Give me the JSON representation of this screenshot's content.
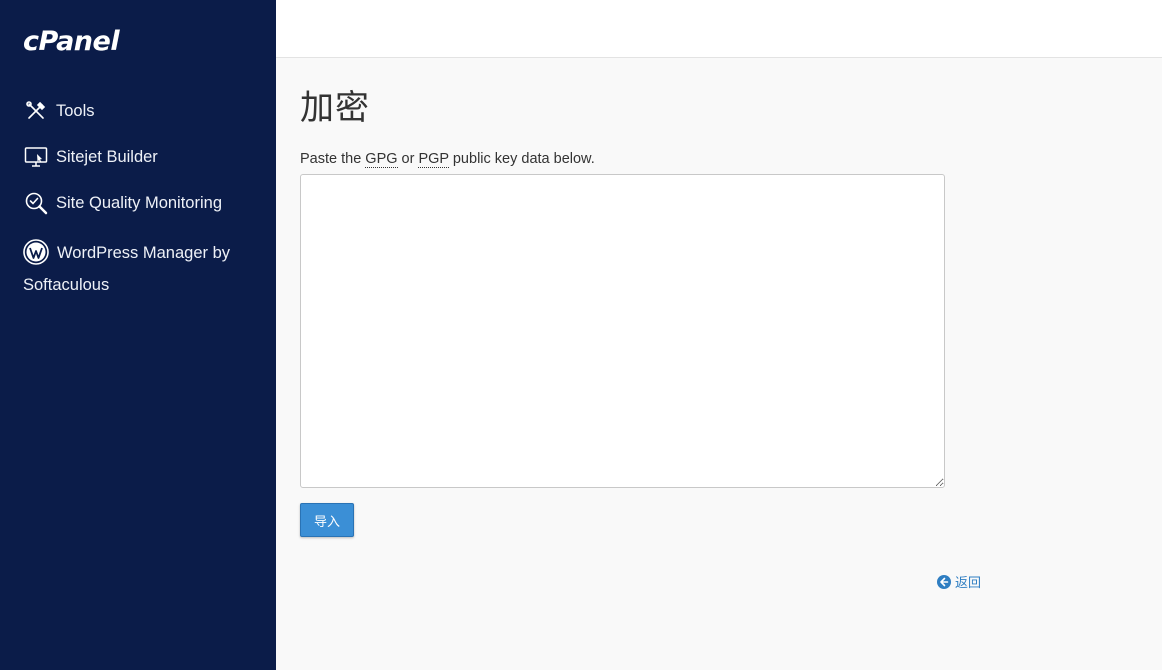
{
  "brand": {
    "logo_text": "cPanel"
  },
  "sidebar": {
    "items": [
      {
        "label": "Tools",
        "icon": "tools-icon"
      },
      {
        "label": "Sitejet Builder",
        "icon": "sitejet-builder-icon"
      },
      {
        "label": "Site Quality Monitoring",
        "icon": "site-quality-icon"
      },
      {
        "label": "WordPress Manager by Softaculous",
        "icon": "wordpress-icon"
      }
    ]
  },
  "main": {
    "title": "加密",
    "instructions": {
      "prefix": "Paste the ",
      "gpg": "GPG",
      "middle": " or ",
      "pgp": "PGP",
      "suffix": " public key data below."
    },
    "key_textarea": {
      "value": ""
    },
    "import_button": "导入",
    "back_link": "返回"
  },
  "colors": {
    "sidebar_bg": "#0b1c49",
    "button_bg": "#3b8fd6",
    "link": "#2f7ec2"
  }
}
